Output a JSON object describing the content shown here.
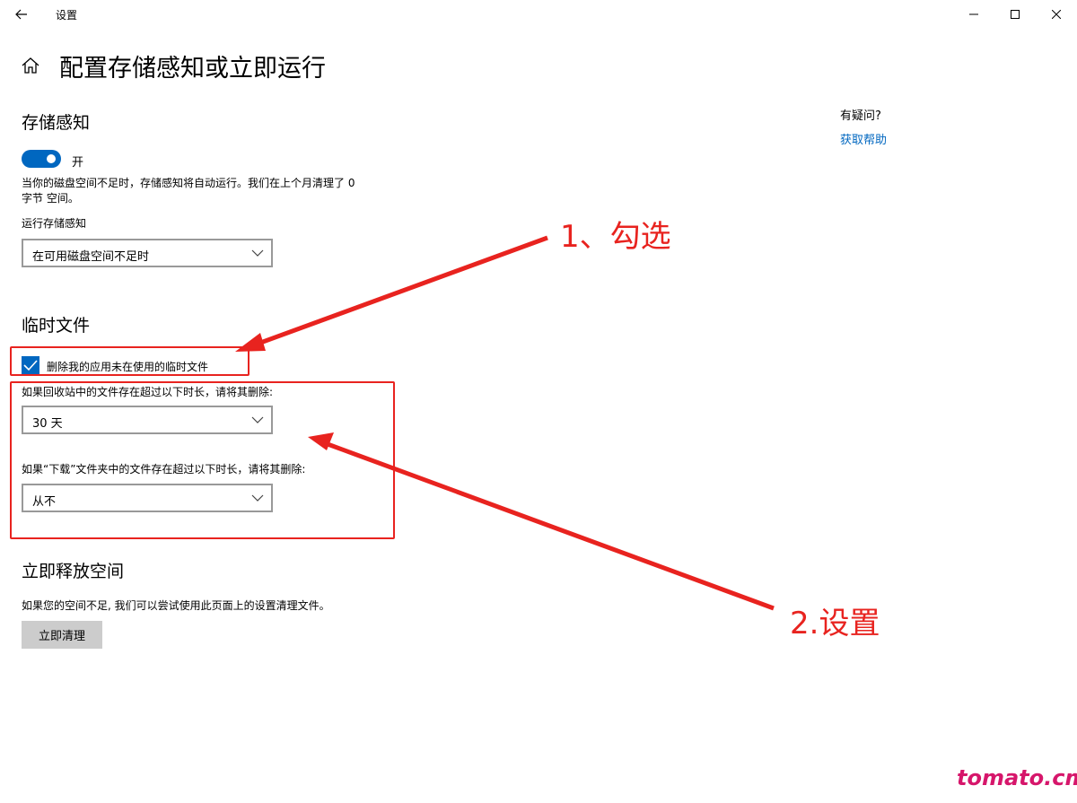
{
  "window": {
    "title": "设置"
  },
  "page": {
    "title": "配置存储感知或立即运行"
  },
  "storage_sense": {
    "heading": "存储感知",
    "toggle_label": "开",
    "toggle_on": true,
    "description_line1": "当你的磁盘空间不足时，存储感知将自动运行。我们在上个月清理了 0",
    "description_line2": "字节 空间。",
    "run_label": "运行存储感知",
    "run_value": "在可用磁盘空间不足时"
  },
  "temp_files": {
    "heading": "临时文件",
    "checkbox_label": "删除我的应用未在使用的临时文件",
    "checkbox_checked": true,
    "recycle_label": "如果回收站中的文件存在超过以下时长，请将其删除:",
    "recycle_value": "30 天",
    "downloads_label": "如果“下载”文件夹中的文件存在超过以下时长，请将其删除:",
    "downloads_value": "从不"
  },
  "free_space": {
    "heading": "立即释放空间",
    "description": "如果您的空间不足, 我们可以尝试使用此页面上的设置清理文件。",
    "button_label": "立即清理"
  },
  "help": {
    "question": "有疑问?",
    "link": "获取帮助"
  },
  "annotations": {
    "step1": "1、勾选",
    "step2": "2.设置",
    "color": "#e8231f"
  },
  "watermark": "tomato.cm",
  "colors": {
    "accent": "#0067c0",
    "button_bg": "#cccccc",
    "watermark": "#d6166b"
  },
  "icons": [
    "back-arrow-icon",
    "minimize-icon",
    "maximize-icon",
    "close-icon",
    "home-icon",
    "chevron-down-icon",
    "checkmark-icon"
  ]
}
